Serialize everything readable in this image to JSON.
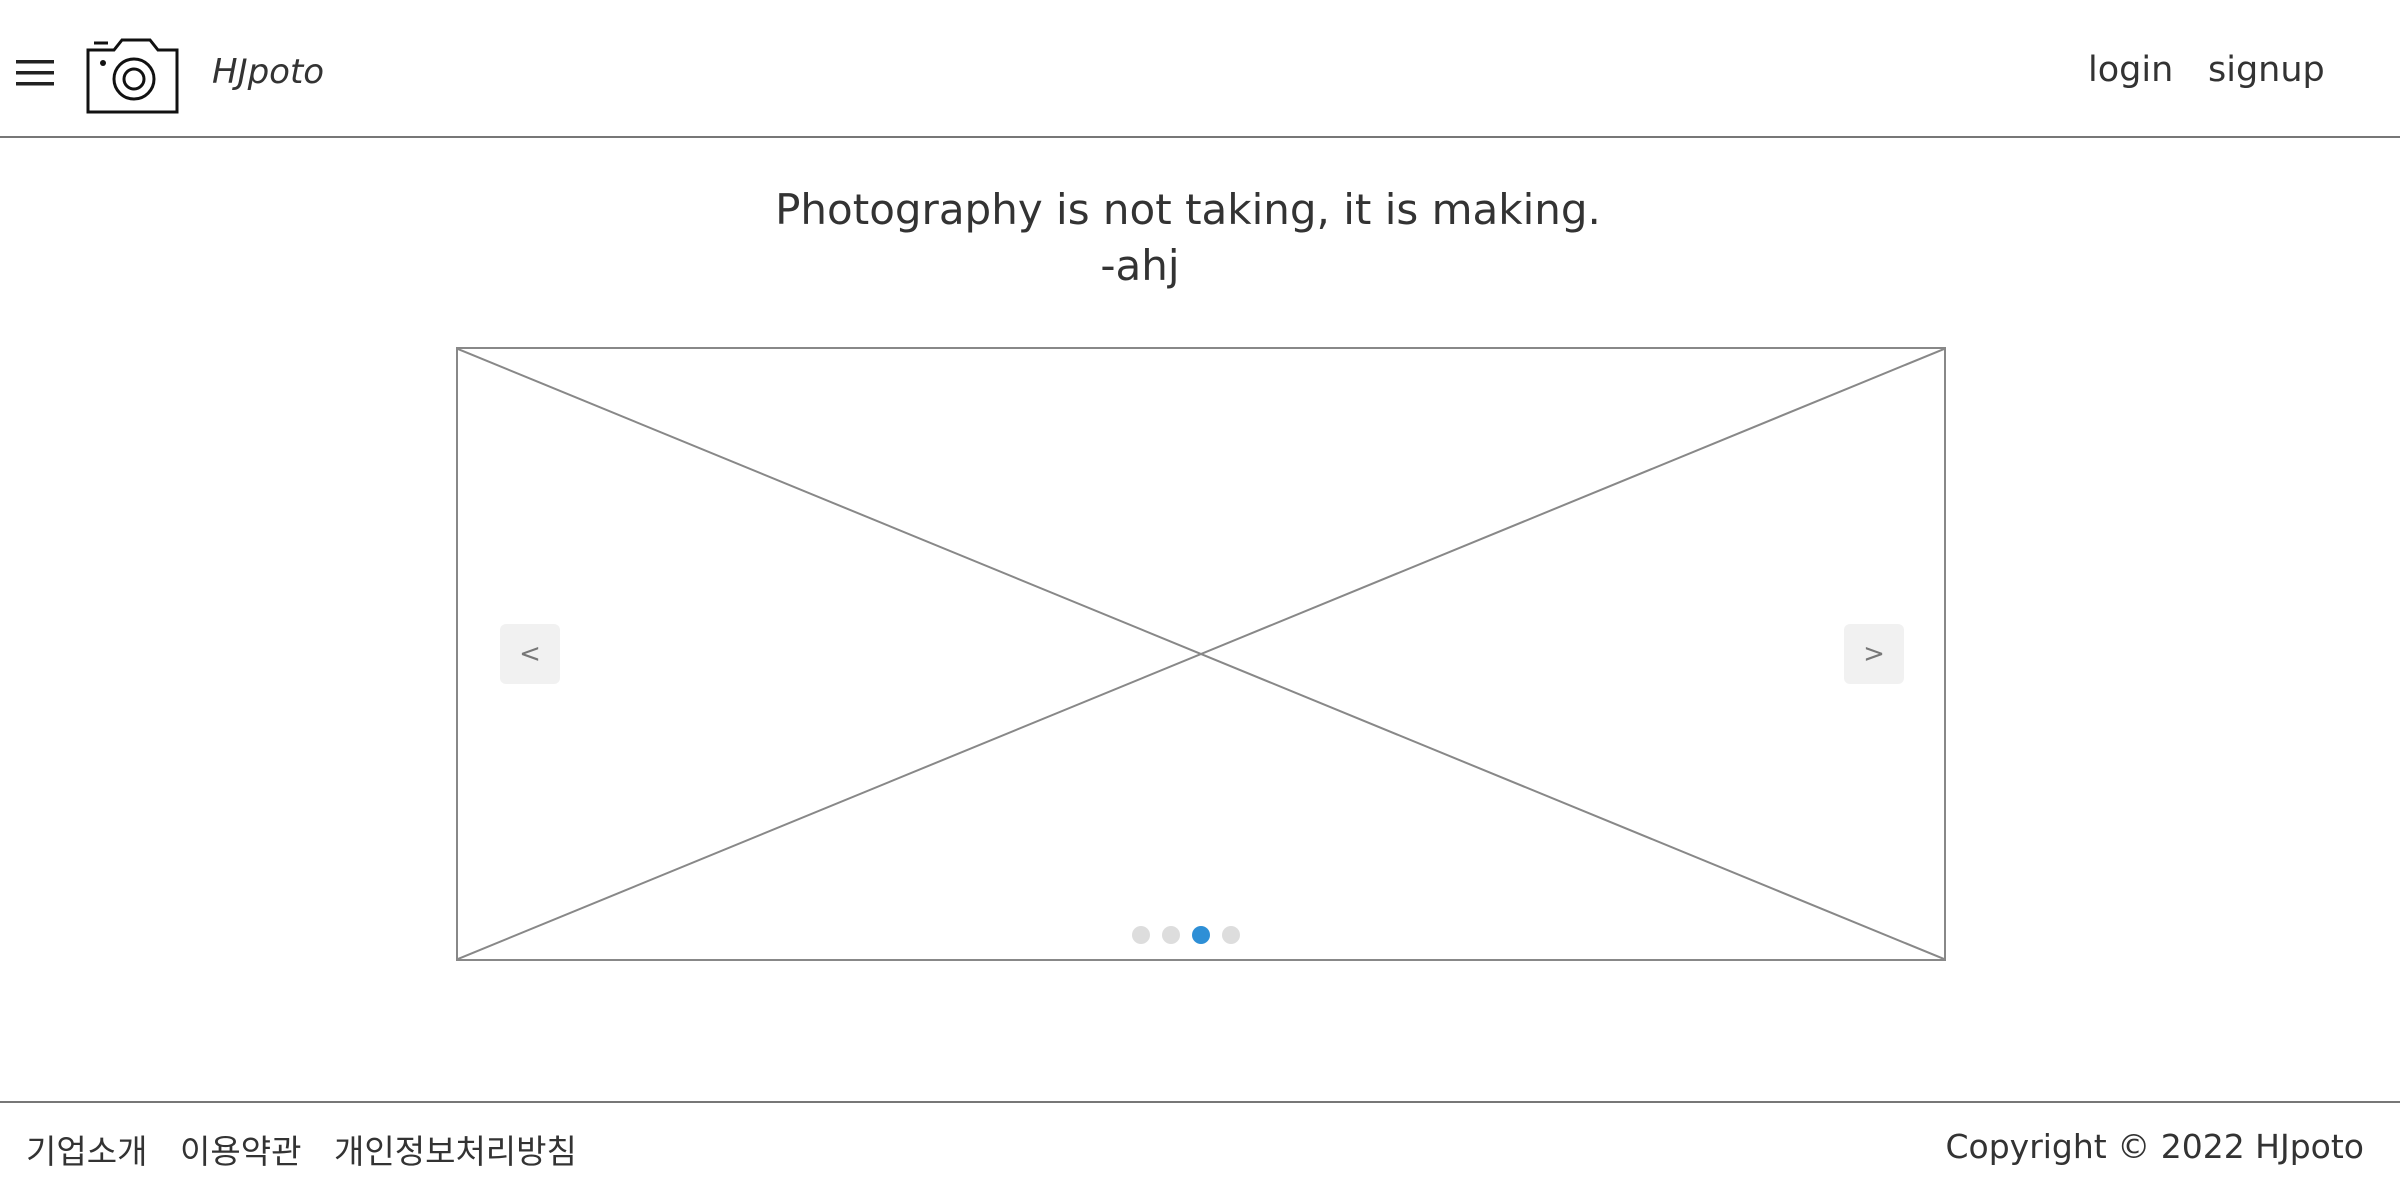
{
  "header": {
    "brand": "HJpoto",
    "login_label": "login",
    "signup_label": "signup",
    "icons": [
      "menu-icon",
      "camera-icon"
    ]
  },
  "quote": {
    "text": "Photography is not taking, it is making.",
    "author": "-ahj"
  },
  "carousel": {
    "prev_label": "<",
    "next_label": ">",
    "slide_count": 4,
    "active_slide": 3,
    "active_color": "#2e8fd6",
    "inactive_color": "#dddddd"
  },
  "footer": {
    "links": [
      "기업소개",
      "이용약관",
      "개인정보처리방침"
    ],
    "copyright": "Copyright © 2022 HJpoto"
  }
}
